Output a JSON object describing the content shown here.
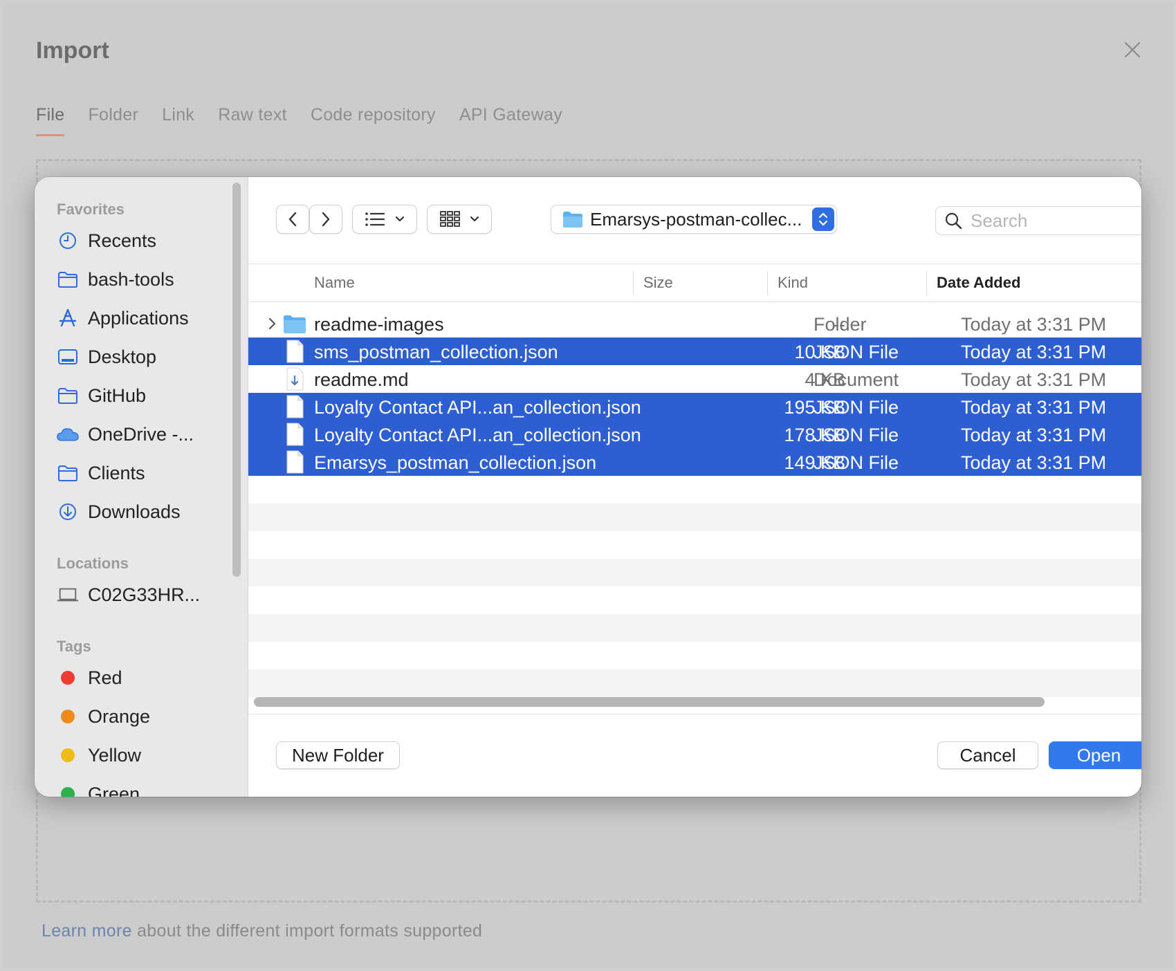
{
  "import": {
    "title": "Import",
    "tabs": [
      {
        "label": "File",
        "active": true
      },
      {
        "label": "Folder"
      },
      {
        "label": "Link"
      },
      {
        "label": "Raw text"
      },
      {
        "label": "Code repository"
      },
      {
        "label": "API Gateway"
      }
    ],
    "learn_more_link": "Learn more",
    "learn_more_text": " about the different import formats supported"
  },
  "sidebar": {
    "favorites_title": "Favorites",
    "favorites": [
      {
        "label": "Recents",
        "icon": "clock-icon"
      },
      {
        "label": "bash-tools",
        "icon": "folder-icon"
      },
      {
        "label": "Applications",
        "icon": "applications-icon"
      },
      {
        "label": "Desktop",
        "icon": "desktop-icon"
      },
      {
        "label": "GitHub",
        "icon": "folder-icon"
      },
      {
        "label": "OneDrive -...",
        "icon": "cloud-icon"
      },
      {
        "label": "Clients",
        "icon": "folder-icon"
      },
      {
        "label": "Downloads",
        "icon": "download-icon"
      }
    ],
    "locations_title": "Locations",
    "locations": [
      {
        "label": "C02G33HR...",
        "icon": "laptop-icon"
      }
    ],
    "tags_title": "Tags",
    "tags": [
      {
        "label": "Red",
        "color": "#f03b30"
      },
      {
        "label": "Orange",
        "color": "#f08b1b"
      },
      {
        "label": "Yellow",
        "color": "#efbc15"
      },
      {
        "label": "Green",
        "color": "#2db14b"
      }
    ]
  },
  "toolbar": {
    "path": "Emarsys-postman-collec...",
    "search_placeholder": "Search"
  },
  "columns": {
    "name": "Name",
    "size": "Size",
    "kind": "Kind",
    "date": "Date Added"
  },
  "files": [
    {
      "name": "readme-images",
      "size": "--",
      "kind": "Folder",
      "date": "Today at 3:31 PM",
      "type": "folder",
      "selected": false
    },
    {
      "name": "sms_postman_collection.json",
      "size": "10 KB",
      "kind": "JSON File",
      "date": "Today at 3:31 PM",
      "type": "file",
      "selected": true
    },
    {
      "name": "readme.md",
      "size": "4 KB",
      "kind": "Document",
      "date": "Today at 3:31 PM",
      "type": "md",
      "selected": false
    },
    {
      "name": "Loyalty Contact API...an_collection.json",
      "size": "195 KB",
      "kind": "JSON File",
      "date": "Today at 3:31 PM",
      "type": "file",
      "selected": true
    },
    {
      "name": "Loyalty Contact API...an_collection.json",
      "size": "178 KB",
      "kind": "JSON File",
      "date": "Today at 3:31 PM",
      "type": "file",
      "selected": true
    },
    {
      "name": "Emarsys_postman_collection.json",
      "size": "149 KB",
      "kind": "JSON File",
      "date": "Today at 3:31 PM",
      "type": "file",
      "selected": true
    }
  ],
  "footer": {
    "new_folder": "New Folder",
    "cancel": "Cancel",
    "open": "Open"
  }
}
